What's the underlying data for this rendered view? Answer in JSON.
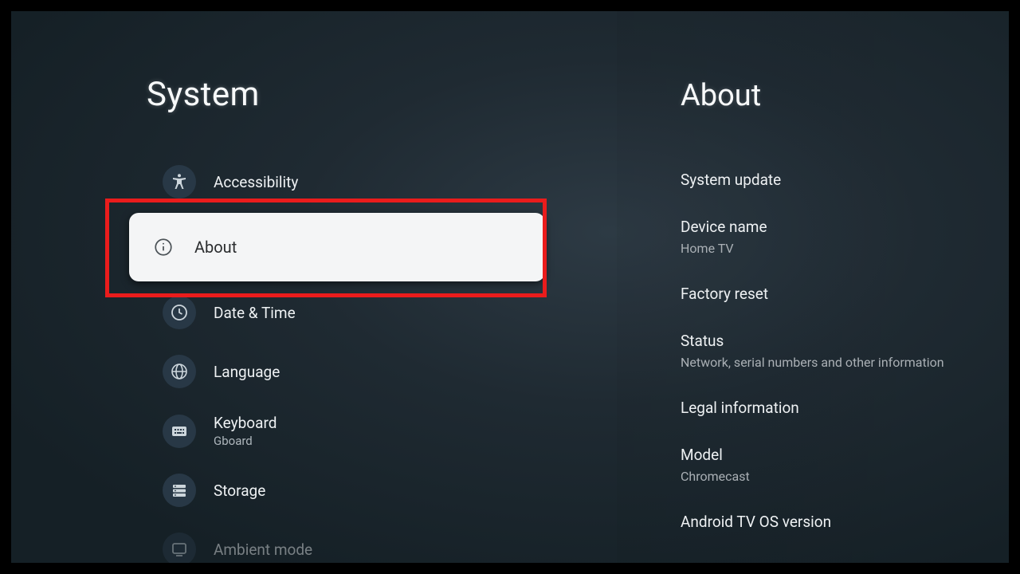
{
  "left": {
    "title": "System",
    "items": [
      {
        "id": "accessibility",
        "label": "Accessibility",
        "icon": "accessibility",
        "selected": false
      },
      {
        "id": "about",
        "label": "About",
        "icon": "info",
        "selected": true
      },
      {
        "id": "date-time",
        "label": "Date & Time",
        "icon": "clock",
        "selected": false
      },
      {
        "id": "language",
        "label": "Language",
        "icon": "globe",
        "selected": false
      },
      {
        "id": "keyboard",
        "label": "Keyboard",
        "sublabel": "Gboard",
        "icon": "keyboard",
        "selected": false
      },
      {
        "id": "storage",
        "label": "Storage",
        "icon": "storage",
        "selected": false
      },
      {
        "id": "ambient",
        "label": "Ambient mode",
        "icon": "ambient",
        "selected": false
      }
    ]
  },
  "right": {
    "title": "About",
    "items": [
      {
        "id": "system-update",
        "label": "System update"
      },
      {
        "id": "device-name",
        "label": "Device name",
        "sub": "Home TV"
      },
      {
        "id": "factory-reset",
        "label": "Factory reset"
      },
      {
        "id": "status",
        "label": "Status",
        "sub": "Network, serial numbers and other information"
      },
      {
        "id": "legal",
        "label": "Legal information"
      },
      {
        "id": "model",
        "label": "Model",
        "sub": "Chromecast"
      },
      {
        "id": "os-version",
        "label": "Android TV OS version"
      }
    ]
  },
  "annotation": {
    "highlight": "about"
  }
}
